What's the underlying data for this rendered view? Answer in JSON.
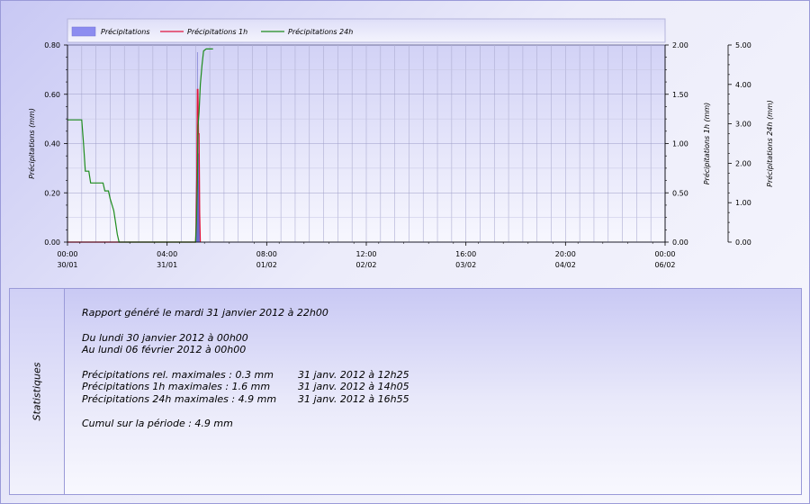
{
  "chart_data": {
    "type": "bar+line",
    "x_ticks": [
      {
        "time": "00:00",
        "date": "30/01"
      },
      {
        "time": "04:00",
        "date": "31/01"
      },
      {
        "time": "08:00",
        "date": "01/02"
      },
      {
        "time": "12:00",
        "date": "02/02"
      },
      {
        "time": "16:00",
        "date": "03/02"
      },
      {
        "time": "20:00",
        "date": "04/02"
      },
      {
        "time": "00:00",
        "date": "06/02"
      }
    ],
    "xlim": [
      "2012-01-30 00:00",
      "2012-02-06 00:00"
    ],
    "grid": true,
    "legend_position": "top",
    "axes": [
      {
        "id": "left",
        "label": "Précipitations (mm)",
        "ylim": [
          0,
          0.8
        ],
        "ticks": [
          "0.00",
          "0.20",
          "0.40",
          "0.60",
          "0.80"
        ]
      },
      {
        "id": "right1",
        "label": "Précipitations 1h (mm)",
        "ylim": [
          0,
          2.0
        ],
        "ticks": [
          "0.00",
          "0.50",
          "1.00",
          "1.50",
          "2.00"
        ]
      },
      {
        "id": "right2",
        "label": "Précipitations 24h (mm)",
        "ylim": [
          0,
          5.0
        ],
        "ticks": [
          "0.00",
          "1.00",
          "2.00",
          "3.00",
          "4.00",
          "5.00"
        ]
      }
    ],
    "series": [
      {
        "name": "Précipitations",
        "kind": "bar",
        "axis": "left",
        "color": "#8c8cf0",
        "points": [
          [
            "2012-01-31 12:10",
            0.1
          ],
          [
            "2012-01-31 12:15",
            0.25
          ],
          [
            "2012-01-31 12:20",
            0.25
          ],
          [
            "2012-01-31 12:25",
            0.52
          ],
          [
            "2012-01-31 12:30",
            0.77
          ],
          [
            "2012-01-31 12:35",
            0.36
          ],
          [
            "2012-01-31 12:40",
            0.25
          ],
          [
            "2012-01-31 12:45",
            0.52
          ],
          [
            "2012-01-31 12:50",
            0.25
          ],
          [
            "2012-01-31 12:55",
            0.36
          ],
          [
            "2012-01-31 13:00",
            0.25
          ],
          [
            "2012-01-31 13:05",
            0.1
          ]
        ]
      },
      {
        "name": "Précipitations 1h",
        "kind": "line",
        "axis": "right1",
        "color": "#e0143c",
        "points": [
          [
            "2012-01-30 00:00",
            0
          ],
          [
            "2012-01-31 12:00",
            0
          ],
          [
            "2012-01-31 12:10",
            0.2
          ],
          [
            "2012-01-31 12:20",
            0.65
          ],
          [
            "2012-01-31 12:30",
            1.55
          ],
          [
            "2012-01-31 12:40",
            1.55
          ],
          [
            "2012-01-31 12:50",
            1.1
          ],
          [
            "2012-01-31 13:00",
            1.1
          ],
          [
            "2012-01-31 13:05",
            0.65
          ],
          [
            "2012-01-31 13:10",
            0.3
          ],
          [
            "2012-01-31 13:20",
            0
          ]
        ]
      },
      {
        "name": "Précipitations 24h",
        "kind": "line",
        "axis": "right2",
        "color": "#1e8c1e",
        "points": [
          [
            "2012-01-30 00:00",
            3.1
          ],
          [
            "2012-01-30 04:00",
            3.1
          ],
          [
            "2012-01-30 04:30",
            2.5
          ],
          [
            "2012-01-30 05:00",
            1.8
          ],
          [
            "2012-01-30 06:00",
            1.8
          ],
          [
            "2012-01-30 06:30",
            1.5
          ],
          [
            "2012-01-30 10:00",
            1.5
          ],
          [
            "2012-01-30 10:30",
            1.3
          ],
          [
            "2012-01-30 11:30",
            1.3
          ],
          [
            "2012-01-30 12:00",
            1.1
          ],
          [
            "2012-01-30 13:00",
            0.8
          ],
          [
            "2012-01-30 13:30",
            0.5
          ],
          [
            "2012-01-30 14:00",
            0.2
          ],
          [
            "2012-01-30 14:30",
            0
          ],
          [
            "2012-01-31 12:00",
            0
          ],
          [
            "2012-01-31 12:15",
            0.5
          ],
          [
            "2012-01-31 12:30",
            1.5
          ],
          [
            "2012-01-31 12:40",
            2.9
          ],
          [
            "2012-01-31 13:00",
            3.3
          ],
          [
            "2012-01-31 13:20",
            4.0
          ],
          [
            "2012-01-31 13:50",
            4.5
          ],
          [
            "2012-01-31 14:15",
            4.85
          ],
          [
            "2012-01-31 15:00",
            4.9
          ],
          [
            "2012-01-31 16:55",
            4.9
          ]
        ]
      }
    ]
  },
  "stats": {
    "title": "Statistiques",
    "report": "Rapport généré le mardi 31 janvier 2012 à 22h00",
    "period_from": "Du lundi 30 janvier 2012 à 00h00",
    "period_to": "Au lundi 06 février 2012 à 00h00",
    "max_rows": [
      {
        "label": "Précipitations rel. maximales : 0.3 mm",
        "when": "31 janv. 2012 à 12h25"
      },
      {
        "label": "Précipitations 1h maximales : 1.6 mm",
        "when": "31 janv. 2012 à 14h05"
      },
      {
        "label": "Précipitations 24h maximales : 4.9 mm",
        "when": "31 janv. 2012 à 16h55"
      }
    ],
    "cumul": "Cumul sur la période : 4.9 mm"
  }
}
